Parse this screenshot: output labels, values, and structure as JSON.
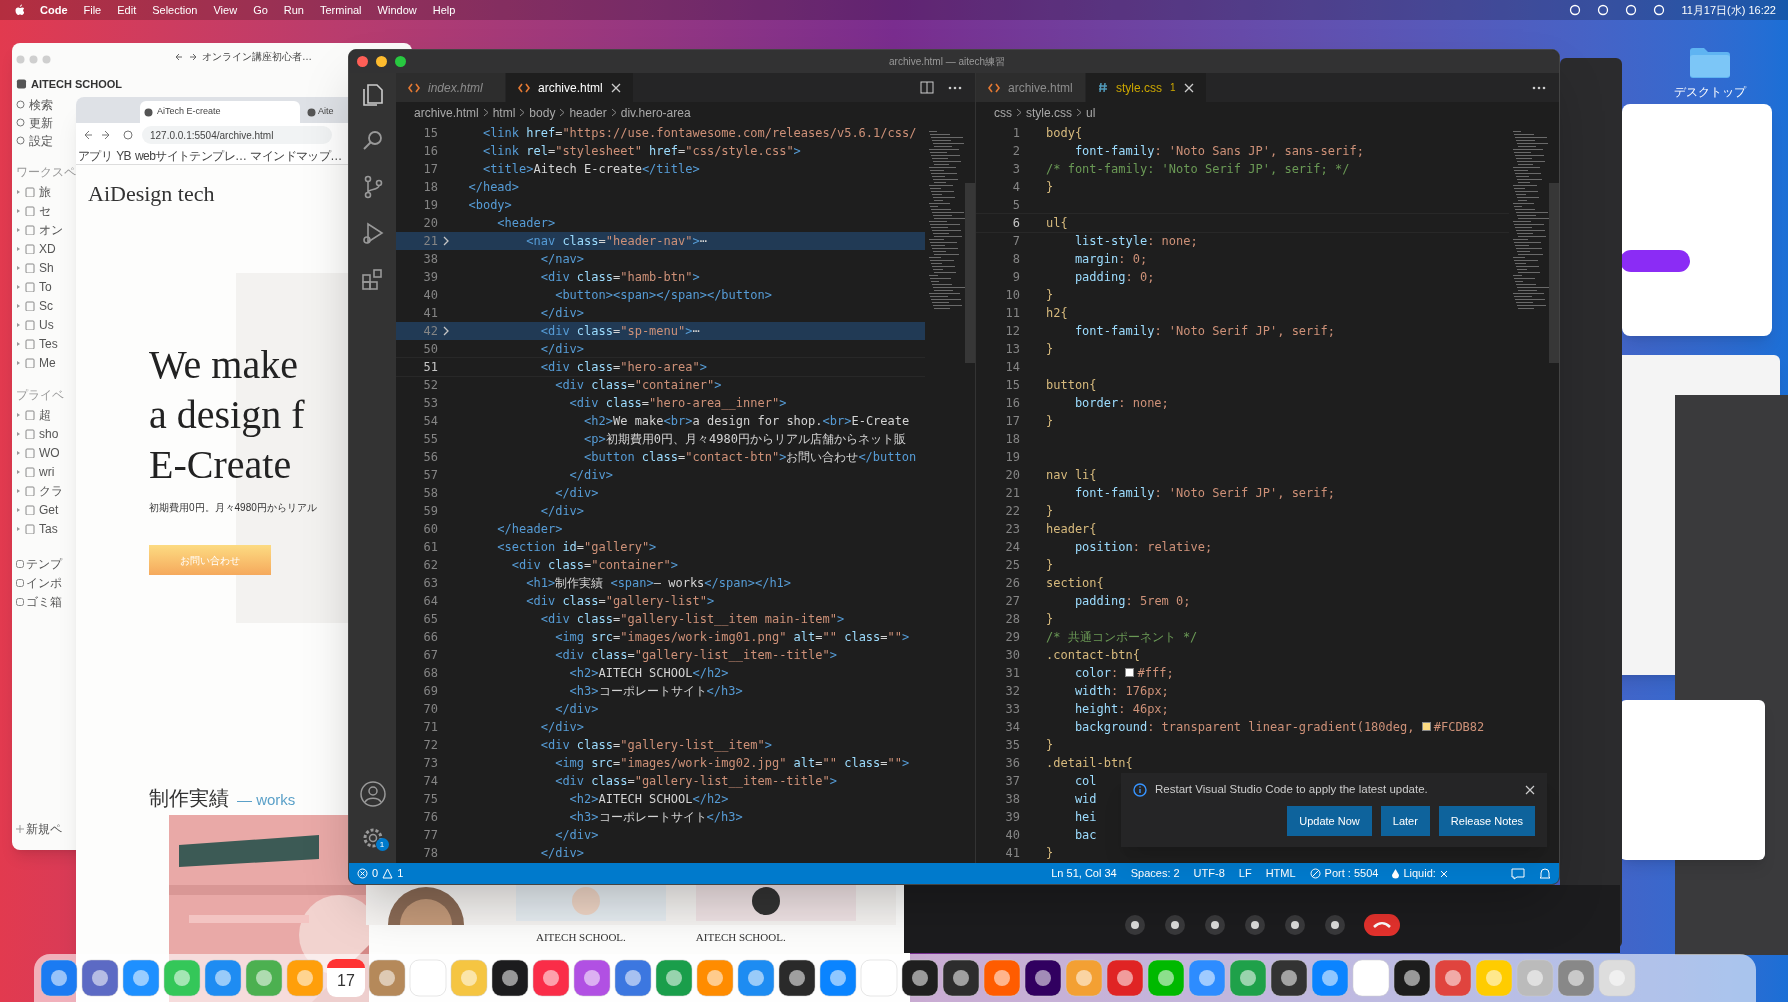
{
  "menu_bar": {
    "items": [
      "Code",
      "File",
      "Edit",
      "Selection",
      "View",
      "Go",
      "Run",
      "Terminal",
      "Window",
      "Help"
    ],
    "clock": "11月17日(水) 16:22"
  },
  "notion": {
    "address": "オンライン講座初心者…",
    "workspace": "AITECH SCHOOL",
    "nav": [
      "検索",
      "更新",
      "設定"
    ],
    "sections": [
      {
        "label": "ワークスペ",
        "items": [
          "旅",
          "セ",
          "オン",
          "XD",
          "Sh",
          "To",
          "Sc",
          "Us",
          "Tes",
          "Me"
        ]
      },
      {
        "label": "プライベ",
        "items": [
          "超",
          "sho",
          "WO",
          "wri",
          "クラ",
          "Get",
          "Tas"
        ]
      }
    ],
    "footer": [
      "テンプ",
      "インポ",
      "ゴミ箱"
    ],
    "new_page": "新規ペ"
  },
  "browser": {
    "tabs": [
      {
        "label": "AiTech E-create",
        "selected": true
      },
      {
        "label": "Aite",
        "selected": false
      }
    ],
    "url": "127.0.0.1:5504/archive.html",
    "bookmarks": [
      "アプリ",
      "YB",
      "webサイトテンプレ…",
      "マインドマップ…"
    ],
    "page": {
      "logo": "AiDesign tech",
      "headline": [
        "We make",
        "a design f",
        "E-Create"
      ],
      "lead": "初期費用0円。月々4980円からリアル",
      "cta": "お問い合わせ",
      "works_title": "制作実績",
      "works_sub": "— works",
      "card_labels": [
        "AITECH SCHOOL.",
        "AITECH SCHOOL."
      ]
    }
  },
  "vscode": {
    "title": "archive.html — aitech練習",
    "settings_badge": "1",
    "groups": [
      {
        "kind": "markup",
        "tabs": [
          {
            "label": "index.html",
            "selected": false,
            "preview": true,
            "kind": "markup",
            "warning": false
          },
          {
            "label": "archive.html",
            "selected": true,
            "preview": false,
            "kind": "markup",
            "warning": false
          }
        ],
        "breadcrumbs": [
          "archive.html",
          "html",
          "body",
          "header",
          "div.hero-area"
        ],
        "lines": [
          {
            "n": "15",
            "text": "    <link href=\"https://use.fontawesome.com/releases/v5.6.1/css/"
          },
          {
            "n": "16",
            "text": "    <link rel=\"stylesheet\" href=\"css/style.css\">"
          },
          {
            "n": "17",
            "text": "    <title>Aitech E-create</title>"
          },
          {
            "n": "18",
            "text": "  </head>"
          },
          {
            "n": "19",
            "text": "  <body>"
          },
          {
            "n": "20",
            "text": "      <header>"
          },
          {
            "n": "21",
            "text": "          <nav class=\"header-nav\">⋯",
            "folded": true
          },
          {
            "n": "38",
            "text": "            </nav>"
          },
          {
            "n": "39",
            "text": "            <div class=\"hamb-btn\">"
          },
          {
            "n": "40",
            "text": "              <button><span></span></button>"
          },
          {
            "n": "41",
            "text": "            </div>"
          },
          {
            "n": "42",
            "text": "            <div class=\"sp-menu\">⋯",
            "folded": true
          },
          {
            "n": "50",
            "text": "            </div>"
          },
          {
            "n": "51",
            "text": "            <div class=\"hero-area\">",
            "current": true
          },
          {
            "n": "52",
            "text": "              <div class=\"container\">"
          },
          {
            "n": "53",
            "text": "                <div class=\"hero-area__inner\">"
          },
          {
            "n": "54",
            "text": "                  <h2>We make<br>a design for shop.<br>E-Create"
          },
          {
            "n": "55",
            "text": "                  <p>初期費用0円、月々4980円からリアル店舗からネット販"
          },
          {
            "n": "56",
            "text": "                  <button class=\"contact-btn\">お問い合わせ</button"
          },
          {
            "n": "57",
            "text": "                </div>"
          },
          {
            "n": "58",
            "text": "              </div>"
          },
          {
            "n": "59",
            "text": "            </div>"
          },
          {
            "n": "60",
            "text": "      </header>"
          },
          {
            "n": "61",
            "text": "      <section id=\"gallery\">"
          },
          {
            "n": "62",
            "text": "        <div class=\"container\">"
          },
          {
            "n": "63",
            "text": "          <h1>制作実績 <span>— works</span></h1>"
          },
          {
            "n": "64",
            "text": "          <div class=\"gallery-list\">"
          },
          {
            "n": "65",
            "text": "            <div class=\"gallery-list__item main-item\">"
          },
          {
            "n": "66",
            "text": "              <img src=\"images/work-img01.png\" alt=\"\" class=\"\">"
          },
          {
            "n": "67",
            "text": "              <div class=\"gallery-list__item--title\">"
          },
          {
            "n": "68",
            "text": "                <h2>AITECH SCHOOL</h2>"
          },
          {
            "n": "69",
            "text": "                <h3>コーポレートサイト</h3>"
          },
          {
            "n": "70",
            "text": "              </div>"
          },
          {
            "n": "71",
            "text": "            </div>"
          },
          {
            "n": "72",
            "text": "            <div class=\"gallery-list__item\">"
          },
          {
            "n": "73",
            "text": "              <img src=\"images/work-img02.jpg\" alt=\"\" class=\"\">"
          },
          {
            "n": "74",
            "text": "              <div class=\"gallery-list__item--title\">"
          },
          {
            "n": "75",
            "text": "                <h2>AITECH SCHOOL</h2>"
          },
          {
            "n": "76",
            "text": "                <h3>コーポレートサイト</h3>"
          },
          {
            "n": "77",
            "text": "              </div>"
          },
          {
            "n": "78",
            "text": "            </div>"
          }
        ]
      },
      {
        "kind": "stylesheet",
        "tabs": [
          {
            "label": "archive.html",
            "selected": false,
            "preview": false,
            "kind": "markup",
            "warning": false
          },
          {
            "label": "style.css",
            "selected": true,
            "preview": false,
            "kind": "stylesheet",
            "warning": true,
            "count": "1"
          }
        ],
        "breadcrumbs": [
          "css",
          "style.css",
          "ul"
        ],
        "lines": [
          {
            "n": "1",
            "text": "body{"
          },
          {
            "n": "2",
            "text": "    font-family: 'Noto Sans JP', sans-serif;"
          },
          {
            "n": "3",
            "text": "/* font-family: 'Noto Serif JP', serif; */"
          },
          {
            "n": "4",
            "text": "}"
          },
          {
            "n": "5"
          },
          {
            "n": "6",
            "text": "ul{",
            "current": true
          },
          {
            "n": "7",
            "text": "    list-style: none;"
          },
          {
            "n": "8",
            "text": "    margin: 0;"
          },
          {
            "n": "9",
            "text": "    padding: 0;"
          },
          {
            "n": "10",
            "text": "}"
          },
          {
            "n": "11",
            "text": "h2{"
          },
          {
            "n": "12",
            "text": "    font-family: 'Noto Serif JP', serif;"
          },
          {
            "n": "13",
            "text": "}"
          },
          {
            "n": "14"
          },
          {
            "n": "15",
            "text": "button{"
          },
          {
            "n": "16",
            "text": "    border: none;"
          },
          {
            "n": "17",
            "text": "}"
          },
          {
            "n": "18"
          },
          {
            "n": "19"
          },
          {
            "n": "20",
            "text": "nav li{"
          },
          {
            "n": "21",
            "text": "    font-family: 'Noto Serif JP', serif;"
          },
          {
            "n": "22",
            "text": "}"
          },
          {
            "n": "23",
            "text": "header{"
          },
          {
            "n": "24",
            "text": "    position: relative;"
          },
          {
            "n": "25",
            "text": "}"
          },
          {
            "n": "26",
            "text": "section{"
          },
          {
            "n": "27",
            "text": "    padding: 5rem 0;"
          },
          {
            "n": "28",
            "text": "}"
          },
          {
            "n": "29",
            "text": "/* 共通コンポーネント */"
          },
          {
            "n": "30",
            "text": ".contact-btn{"
          },
          {
            "n": "31",
            "text": "    color: ",
            "kind": "color",
            "after": "#fff;"
          },
          {
            "n": "32",
            "text": "    width: 176px;"
          },
          {
            "n": "33",
            "text": "    height: 46px;"
          },
          {
            "n": "34",
            "text": "    background: transparent linear-gradient(180deg, ",
            "kind": "color",
            "after": "#FCDB82"
          },
          {
            "n": "35",
            "text": "}"
          },
          {
            "n": "36",
            "text": ".detail-btn{"
          },
          {
            "n": "37",
            "text": "    col"
          },
          {
            "n": "38",
            "text": "    wid"
          },
          {
            "n": "39",
            "text": "    hei"
          },
          {
            "n": "40",
            "text": "    bac"
          },
          {
            "n": "41",
            "text": "}"
          }
        ]
      }
    ],
    "notification": {
      "message": "Restart Visual Studio Code to apply the latest update.",
      "buttons": [
        "Update Now",
        "Later",
        "Release Notes"
      ]
    },
    "status_bar": {
      "errors": "0",
      "warnings": "1",
      "right": [
        {
          "kind": "text",
          "label": "Ln 51, Col 34"
        },
        {
          "kind": "text",
          "label": "Spaces: 2"
        },
        {
          "kind": "text",
          "label": "UTF-8"
        },
        {
          "kind": "text",
          "label": "LF"
        },
        {
          "kind": "text",
          "label": "HTML"
        },
        {
          "kind": "port",
          "label": "Port : 5504"
        },
        {
          "kind": "liquid",
          "label": "Liquid:"
        }
      ]
    }
  },
  "desktop": {
    "folder_label": "デスクトップ"
  },
  "dock": {
    "calendar_day": "17"
  }
}
